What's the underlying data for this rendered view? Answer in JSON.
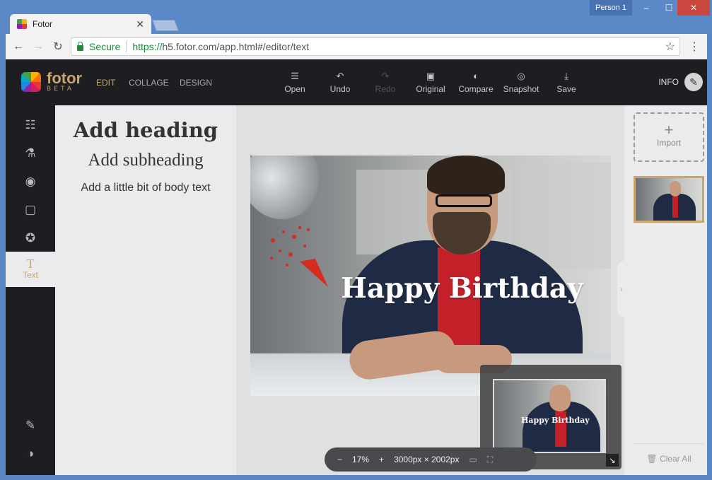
{
  "browser": {
    "tab_title": "Fotor",
    "profile": "Person 1",
    "secure_label": "Secure",
    "url_scheme": "https://",
    "url_rest": "h5.fotor.com/app.html#/editor/text"
  },
  "app": {
    "logo_name": "fotor",
    "logo_beta": "BETA",
    "modes": [
      "EDIT",
      "COLLAGE",
      "DESIGN"
    ],
    "active_mode": "EDIT",
    "tools": {
      "open": "Open",
      "undo": "Undo",
      "redo": "Redo",
      "original": "Original",
      "compare": "Compare",
      "snapshot": "Snapshot",
      "save": "Save"
    },
    "info": "INFO"
  },
  "sidebar": {
    "active_label": "Text",
    "icons": [
      "sliders-icon",
      "flask-icon",
      "eye-icon",
      "frame-icon",
      "sticker-star-icon",
      "text-icon",
      "edit-icon",
      "theme-icon"
    ]
  },
  "text_panel": {
    "heading": "Add heading",
    "subheading": "Add subheading",
    "body": "Add a little bit of body text"
  },
  "canvas": {
    "overlay_text": "Happy Birthday",
    "zoom": "17%",
    "dimensions": "3000px × 2002px"
  },
  "right_panel": {
    "import_label": "Import",
    "clear_all": "Clear All"
  },
  "colors": {
    "accent": "#c9a66b",
    "topbar": "#1e1e22",
    "panel": "#ebebee",
    "chrome_frame": "#5b88c6"
  }
}
